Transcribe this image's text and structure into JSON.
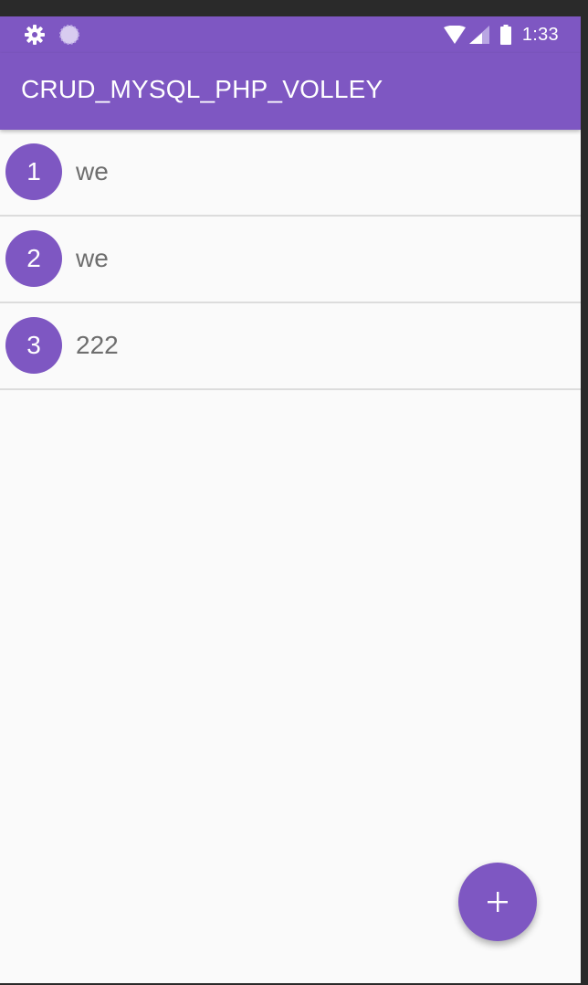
{
  "status_bar": {
    "time": "1:33",
    "left_icons": [
      "gear-icon",
      "sync-icon"
    ],
    "right_icons": [
      "wifi-icon",
      "cell-signal-icon",
      "battery-icon"
    ]
  },
  "app_bar": {
    "title": "CRUD_MYSQL_PHP_VOLLEY"
  },
  "list": {
    "items": [
      {
        "id": "1",
        "text": "we"
      },
      {
        "id": "2",
        "text": "we"
      },
      {
        "id": "3",
        "text": "222"
      }
    ]
  },
  "fab": {
    "icon": "plus-icon"
  },
  "colors": {
    "primary": "#7e57c2",
    "background": "#fafafa",
    "divider": "#dcdcdc",
    "item_text": "#6e6e6e"
  }
}
